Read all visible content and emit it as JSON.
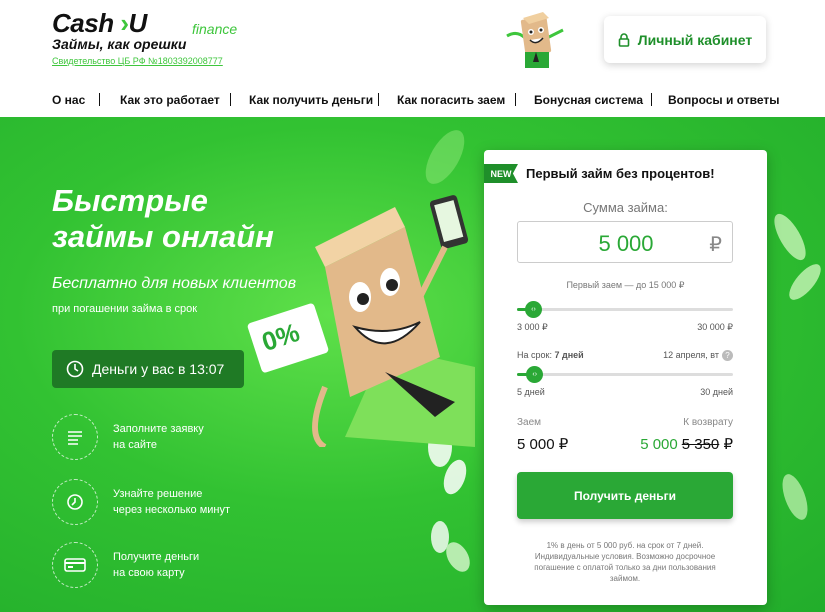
{
  "header": {
    "logo_main": "Cash",
    "logo_arrow": "›",
    "logo_u": "U",
    "logo_sub": "finance",
    "slogan": "Займы, как орешки",
    "cert": "Свидетельство ЦБ РФ №1803392008777",
    "cabinet_label": "Личный кабинет"
  },
  "nav": [
    "О нас",
    "Как это работает",
    "Как получить деньги",
    "Как погасить заем",
    "Бонусная система",
    "Вопросы и ответы"
  ],
  "hero": {
    "title_line1": "Быстрые",
    "title_line2": "займы онлайн",
    "sub1": "Бесплатно для новых клиентов",
    "sub2": "при погашении займа в срок",
    "badge": "0%",
    "timer": "Деньги у вас в 13:07",
    "steps": [
      {
        "line1": "Заполните заявку",
        "line2": "на сайте",
        "icon": "form-icon"
      },
      {
        "line1": "Узнайте решение",
        "line2": "через несколько минут",
        "icon": "clock-icon"
      },
      {
        "line1": "Получите деньги",
        "line2": "на свою карту",
        "icon": "card-icon"
      }
    ]
  },
  "calculator": {
    "badge": "NEW",
    "title": "Первый займ без процентов!",
    "amount_label": "Сумма займа:",
    "amount_value": "5 000",
    "currency": "₽",
    "first_loan_hint": "Первый заем — до 15 000 ₽",
    "amount_min": "3 000 ₽",
    "amount_max": "30 000 ₽",
    "amount_fraction": 0.074,
    "term_label": "На срок:",
    "term_value": "7 дней",
    "return_date": "12 апреля, вт",
    "help_mark": "?",
    "term_min": "5 дней",
    "term_max": "30 дней",
    "term_fraction": 0.08,
    "loan_label": "Заем",
    "loan_value": "5 000 ₽",
    "return_label": "К возврату",
    "return_value": "5 000",
    "return_old": "5 350",
    "return_currency": "₽",
    "cta": "Получить деньги",
    "disclaimer": "1% в день от 5 000 руб. на срок от 7 дней. Индивидуальные условия. Возможно досрочное погашение с оплатой только за дни пользования займом."
  },
  "colors": {
    "brand_green": "#2aa836",
    "dark_green": "#1f7a25",
    "hero_bg": "#32c232"
  }
}
